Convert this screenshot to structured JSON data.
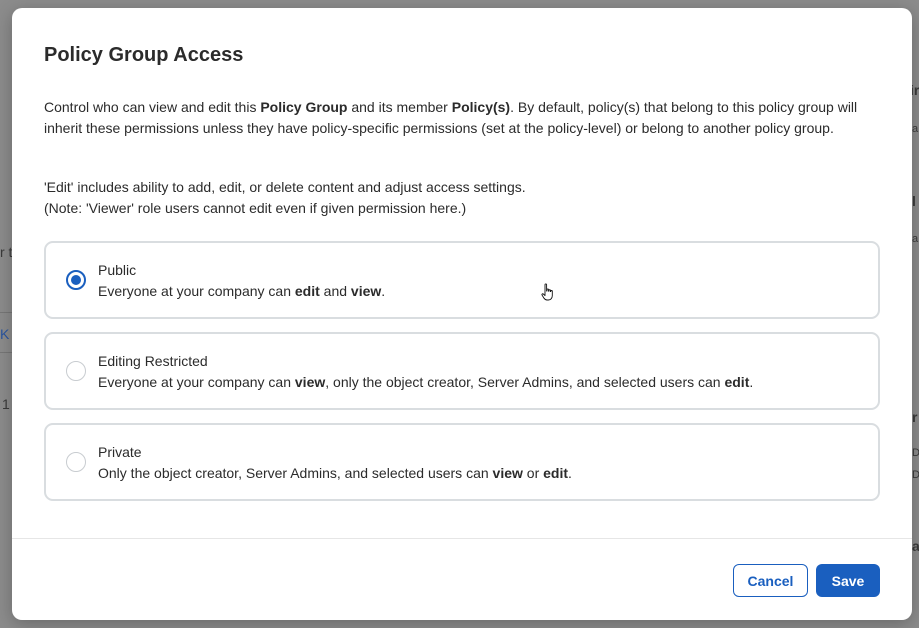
{
  "background": {
    "fragments": [
      "r t",
      "K",
      "1",
      "ir",
      "a",
      "a",
      "l",
      "r",
      "D",
      "D",
      "a"
    ]
  },
  "modal": {
    "title": "Policy Group Access",
    "description": {
      "part1": "Control who can view and edit this ",
      "bold1": "Policy Group",
      "part2": " and its member ",
      "bold2": "Policy(s)",
      "part3": ". By default, policy(s) that belong to this policy group will inherit these permissions unless they have policy-specific permissions (set at the policy-level) or belong to another policy group."
    },
    "note_line1": "'Edit' includes ability to add, edit, or delete content and adjust access settings.",
    "note_line2": "(Note: 'Viewer' role users cannot edit even if given permission here.)",
    "options": [
      {
        "title": "Public",
        "desc_a": "Everyone at your company can ",
        "desc_b": "edit",
        "desc_c": " and ",
        "desc_d": "view",
        "desc_e": ".",
        "selected": true
      },
      {
        "title": "Editing Restricted",
        "desc_a": "Everyone at your company can ",
        "desc_b": "view",
        "desc_c": ", only the object creator, Server Admins, and selected users can ",
        "desc_d": "edit",
        "desc_e": ".",
        "selected": false
      },
      {
        "title": "Private",
        "desc_a": "Only the object creator, Server Admins, and selected users can ",
        "desc_b": "view",
        "desc_c": " or ",
        "desc_d": "edit",
        "desc_e": ".",
        "selected": false
      }
    ],
    "buttons": {
      "cancel": "Cancel",
      "save": "Save"
    }
  },
  "colors": {
    "accent": "#1a5fbf",
    "border": "#d9dde0",
    "backdrop": "#8c8c8c"
  },
  "icons": {
    "cursor": "hand-pointer-icon"
  }
}
